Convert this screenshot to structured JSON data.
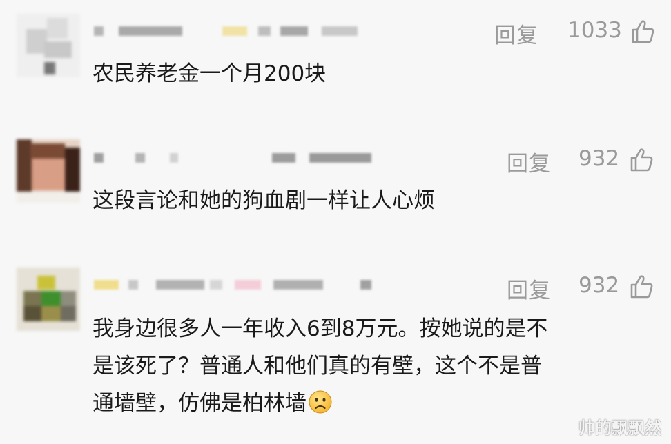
{
  "comments": [
    {
      "reply_label": "回复",
      "likes": "1033",
      "lines": [
        "农民养老金一个月200块"
      ]
    },
    {
      "reply_label": "回复",
      "likes": "932",
      "lines": [
        "这段言论和她的狗血剧一样让人心烦"
      ]
    },
    {
      "reply_label": "回复",
      "likes": "932",
      "lines": [
        "我身边很多人一年收入6到8万元。按她说的是不",
        "是该死了？普通人和他们真的有壁，这个不是普",
        "通墙壁，仿佛是柏林墙"
      ],
      "trailing_icon": "sad-face-emoji"
    }
  ],
  "watermark": "帅的飘飘然",
  "icons": {
    "like": "thumbs-up-icon",
    "emoji": "sad-face-emoji"
  },
  "colors": {
    "background": "#f7f7f7",
    "text": "#1a1a1a",
    "meta": "#9a9a9a"
  }
}
